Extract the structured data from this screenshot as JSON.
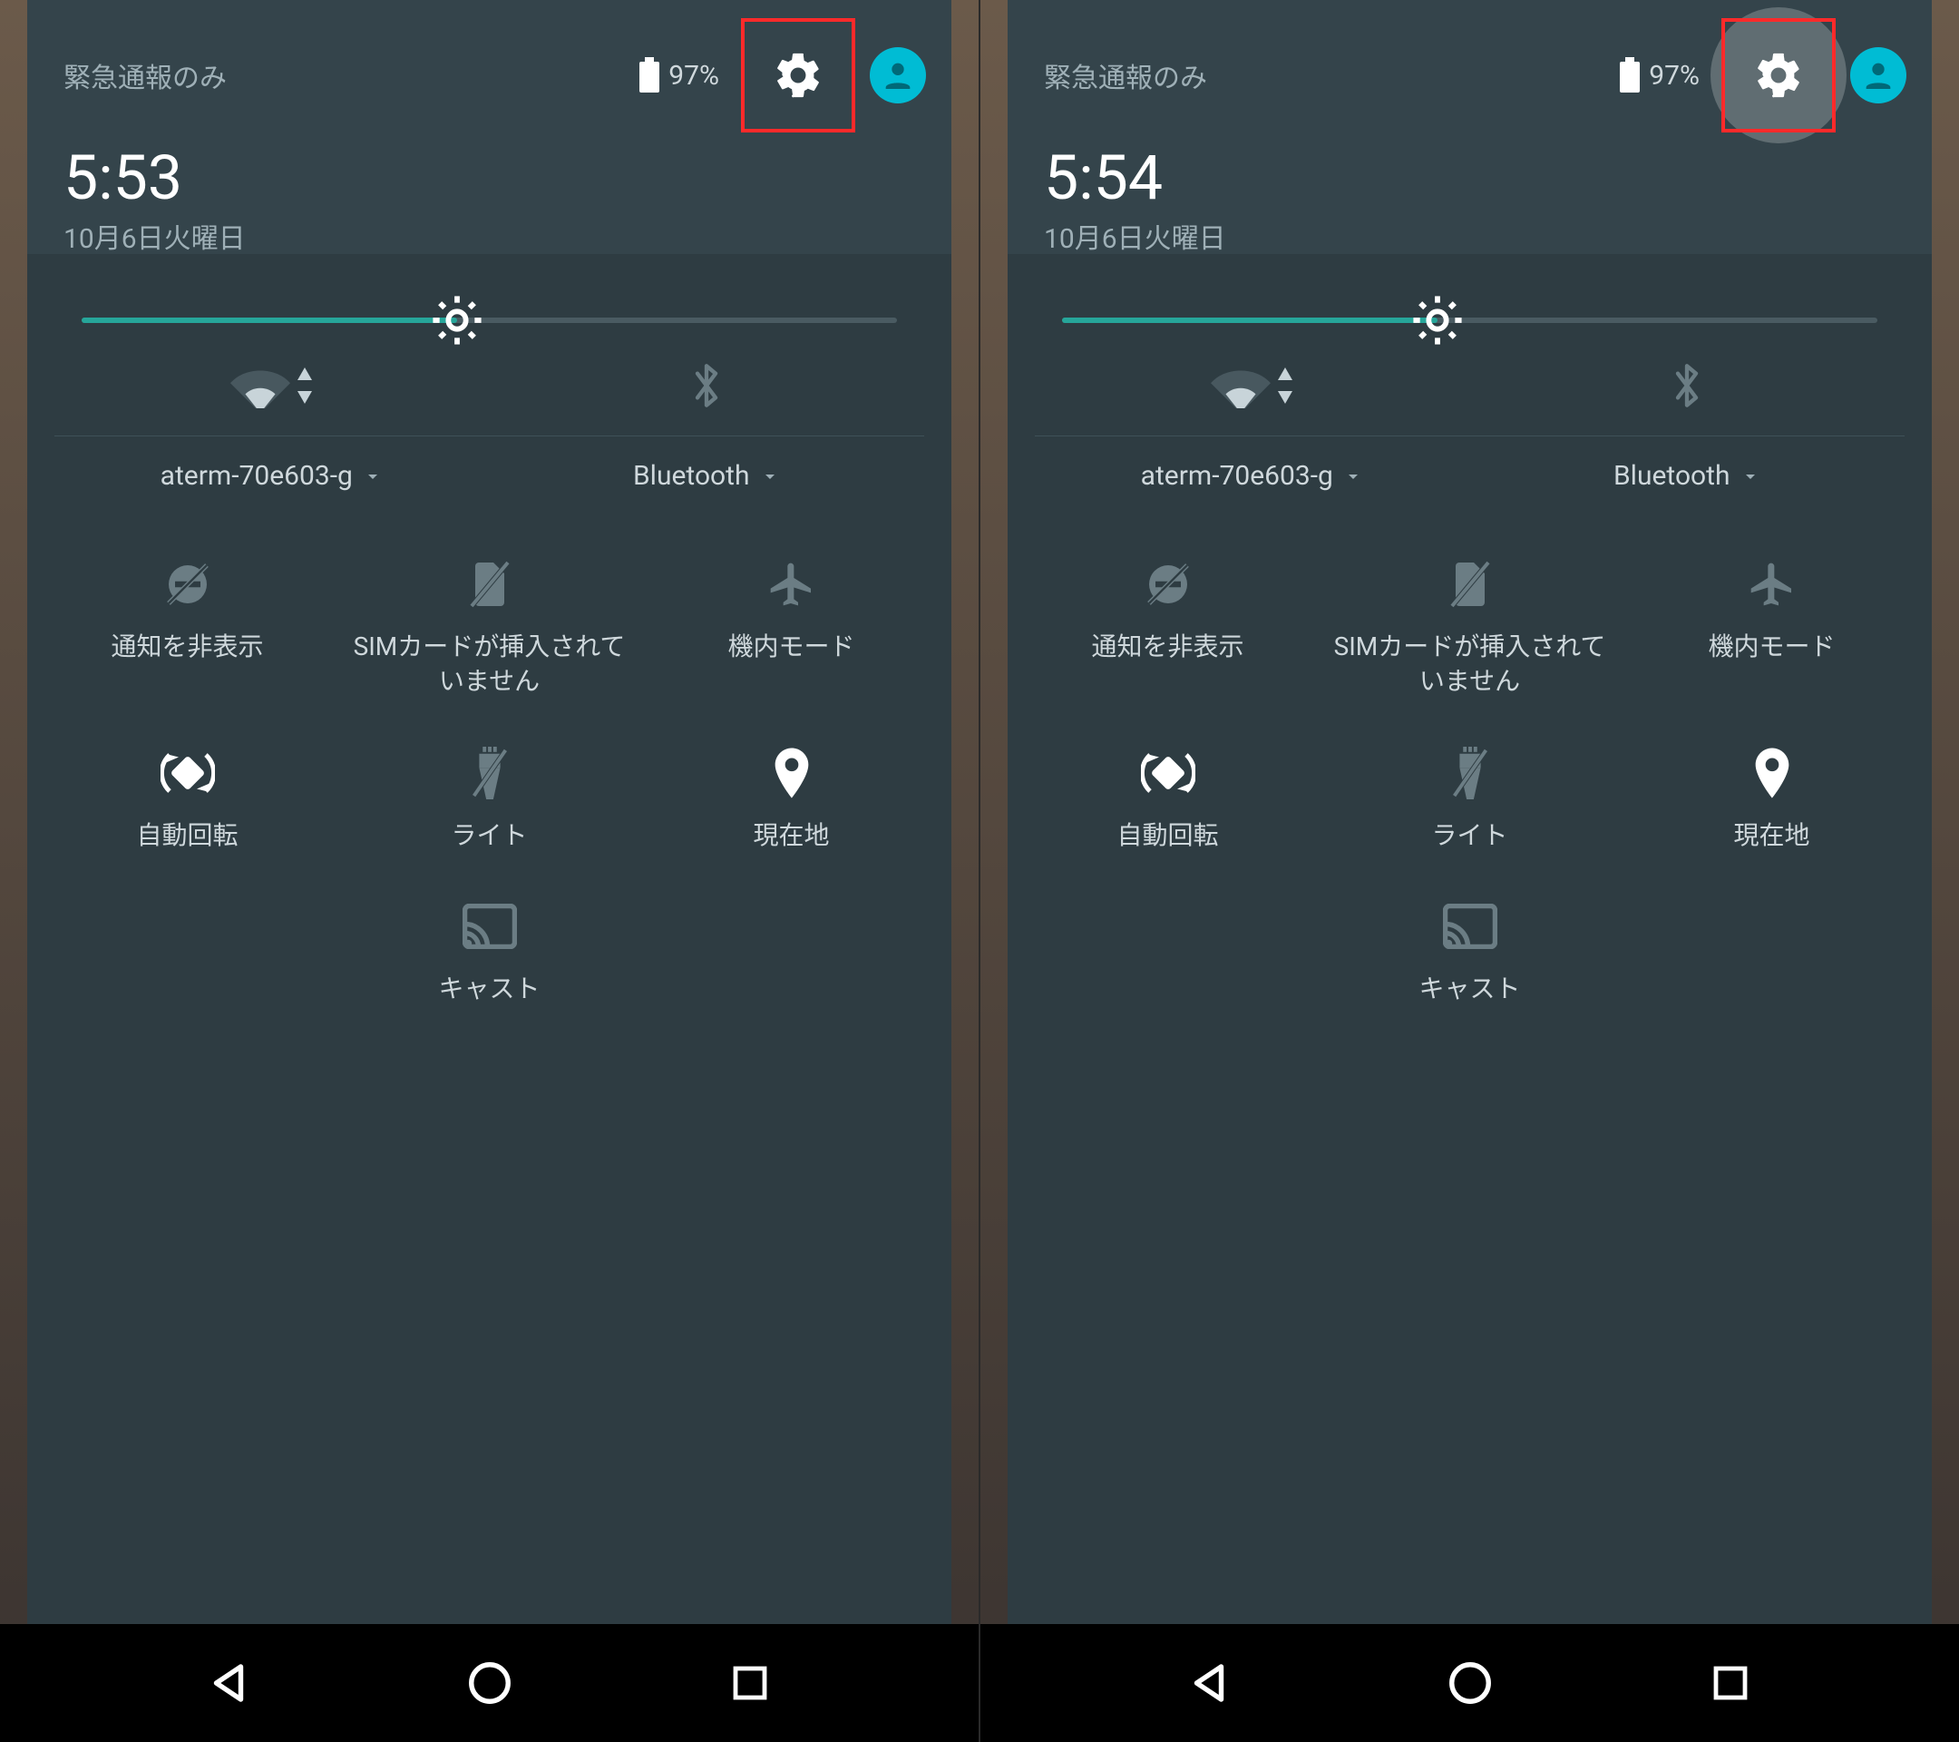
{
  "panels": [
    {
      "carrier": "緊急通報のみ",
      "battery": "97%",
      "time": "5:53",
      "date": "10月6日火曜日",
      "ripple": false
    },
    {
      "carrier": "緊急通報のみ",
      "battery": "97%",
      "time": "5:54",
      "date": "10月6日火曜日",
      "ripple": true
    }
  ],
  "brightness_percent": 46,
  "big_tiles": {
    "wifi": "aterm-70e603-g",
    "bluetooth": "Bluetooth"
  },
  "tiles": {
    "dnd": "通知を非表示",
    "sim": "SIMカードが挿入されていません",
    "airplane": "機内モード",
    "rotate": "自動回転",
    "flashlight": "ライト",
    "location": "現在地",
    "cast": "キャスト"
  }
}
